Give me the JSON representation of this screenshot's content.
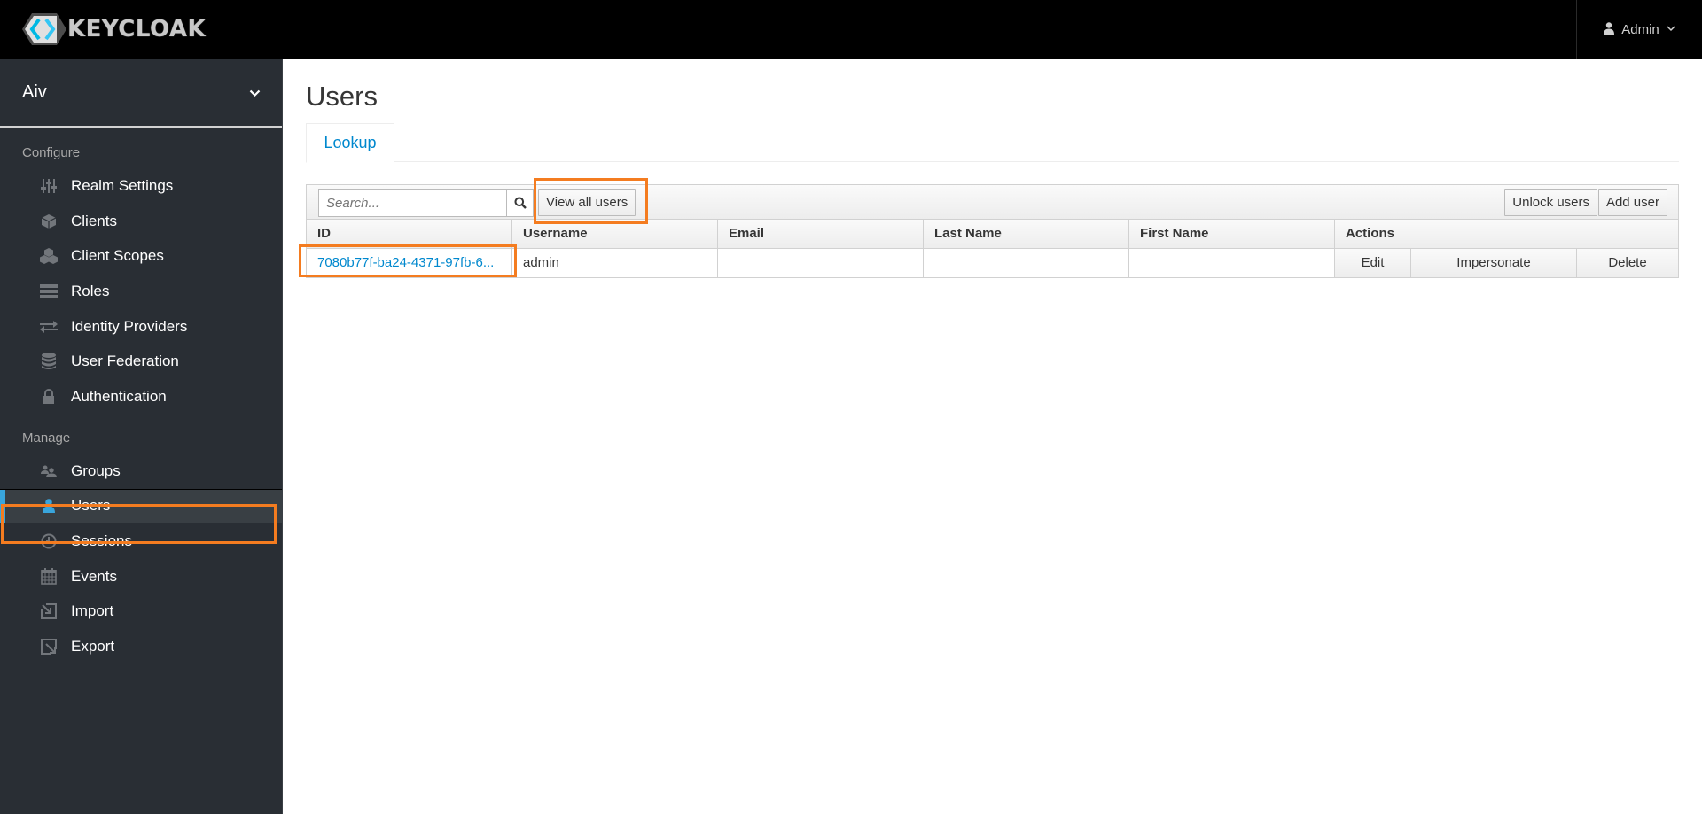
{
  "header": {
    "brand": "KEYCLOAK",
    "user_menu_label": "Admin"
  },
  "sidebar": {
    "realm_name": "Aiv",
    "configure_label": "Configure",
    "manage_label": "Manage",
    "configure_items": [
      {
        "label": "Realm Settings",
        "icon": "sliders-icon"
      },
      {
        "label": "Clients",
        "icon": "cube-icon"
      },
      {
        "label": "Client Scopes",
        "icon": "cubes-icon"
      },
      {
        "label": "Roles",
        "icon": "list-icon"
      },
      {
        "label": "Identity Providers",
        "icon": "exchange-icon"
      },
      {
        "label": "User Federation",
        "icon": "database-icon"
      },
      {
        "label": "Authentication",
        "icon": "lock-icon"
      }
    ],
    "manage_items": [
      {
        "label": "Groups",
        "icon": "users-icon"
      },
      {
        "label": "Users",
        "icon": "user-icon",
        "active": true
      },
      {
        "label": "Sessions",
        "icon": "clock-icon"
      },
      {
        "label": "Events",
        "icon": "calendar-icon"
      },
      {
        "label": "Import",
        "icon": "import-icon"
      },
      {
        "label": "Export",
        "icon": "export-icon"
      }
    ]
  },
  "main": {
    "title": "Users",
    "tabs": [
      {
        "label": "Lookup",
        "active": true
      }
    ],
    "toolbar": {
      "search_placeholder": "Search...",
      "search_value": "",
      "view_all_label": "View all users",
      "unlock_label": "Unlock users",
      "add_user_label": "Add user"
    },
    "table": {
      "columns": [
        "ID",
        "Username",
        "Email",
        "Last Name",
        "First Name",
        "Actions"
      ],
      "rows": [
        {
          "id": "7080b77f-ba24-4371-97fb-6...",
          "username": "admin",
          "email": "",
          "last_name": "",
          "first_name": "",
          "actions": [
            "Edit",
            "Impersonate",
            "Delete"
          ]
        }
      ]
    }
  },
  "colors": {
    "accent": "#39a5dc",
    "link": "#0088ce",
    "highlight": "#f47c20",
    "sidebar_bg": "#292e34",
    "topbar_bg": "#000000"
  }
}
